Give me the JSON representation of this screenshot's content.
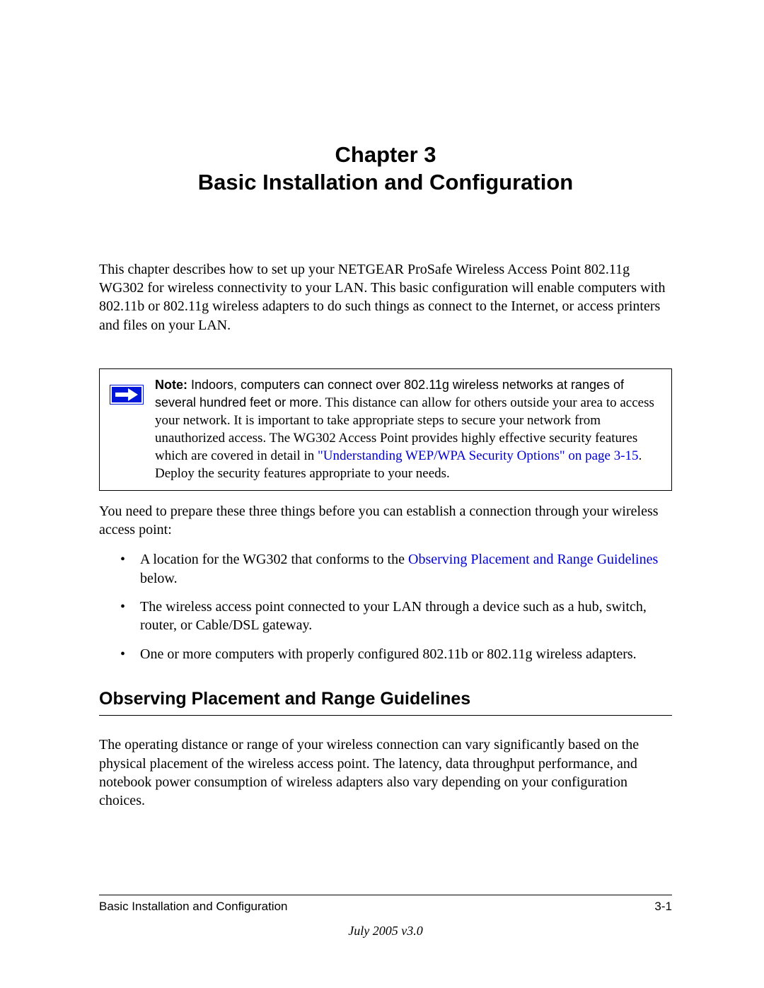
{
  "heading": {
    "line1": "Chapter 3",
    "line2": "Basic Installation and Configuration"
  },
  "intro": "This chapter describes how to set up your NETGEAR ProSafe Wireless Access Point 802.11g WG302 for wireless connectivity to your LAN. This basic configuration will enable computers with 802.11b or 802.11g wireless adapters to do such things as connect to the Internet, or access printers and files on your LAN.",
  "note": {
    "bold_label": "Note:",
    "lead_text": " Indoors, computers can connect over 802.11g wireless networks at ranges of several hundred feet or more.",
    "body_before_link": " This distance can allow for others outside your area to access your network. It is important to take appropriate steps to secure your network from unauthorized access. The WG302 Access Point provides highly effective security features which are covered in detail in ",
    "link_text": "\"Understanding WEP/WPA Security Options\" on page 3-15",
    "body_after_link": ". Deploy the security features appropriate to your needs."
  },
  "after_note": "You need to prepare these three things before you can establish a connection through your wireless access point:",
  "bullets": [
    {
      "pre": "A location for the WG302 that conforms to the ",
      "link": "Observing Placement and Range Guidelines",
      "post": " below."
    },
    {
      "pre": "The wireless access point connected to your LAN through a device such as a hub, switch, router, or Cable/DSL gateway.",
      "link": "",
      "post": ""
    },
    {
      "pre": "One or more computers with properly configured 802.11b or 802.11g wireless adapters.",
      "link": "",
      "post": ""
    }
  ],
  "section_heading": "Observing Placement and Range Guidelines",
  "section_body": "The operating distance or range of your wireless connection can vary significantly based on the physical placement of the wireless access point. The latency, data throughput performance, and notebook power consumption of wireless adapters also vary depending on your configuration choices.",
  "footer": {
    "left": "Basic Installation and Configuration",
    "right": "3-1",
    "date": "July 2005 v3.0"
  }
}
